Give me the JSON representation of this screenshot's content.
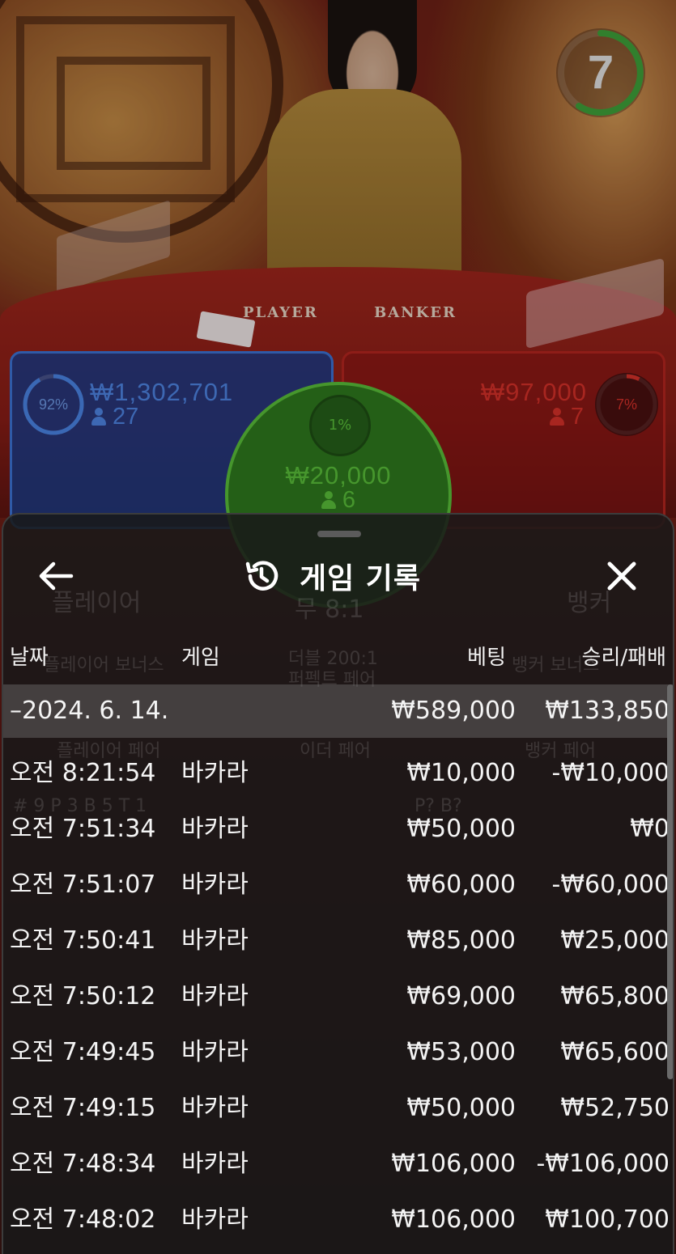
{
  "live_table": {
    "felt_labels": {
      "player": "PLAYER",
      "banker": "BANKER"
    },
    "countdown": {
      "value": "7",
      "ring_color": "#3fa33a"
    },
    "player_spot": {
      "percent": "92%",
      "stake": "₩1,302,701",
      "players": "27",
      "color": "#3d74d6"
    },
    "banker_spot": {
      "percent": "7%",
      "stake": "₩97,000",
      "players": "7",
      "color": "#d8312a"
    },
    "tie_spot": {
      "percent": "1%",
      "stake": "₩20,000",
      "players": "6",
      "color": "#5ac13a"
    }
  },
  "sheet": {
    "title": "게임 기록",
    "icons": {
      "back": "arrow-left-icon",
      "history": "history-icon",
      "close": "close-icon"
    },
    "columns": {
      "date": "날짜",
      "game": "게임",
      "bet": "베팅",
      "win_loss": "승리/패배"
    },
    "summary": {
      "date": "–2024. 6. 14.",
      "bet": "₩589,000",
      "win_loss": "₩133,850"
    },
    "rows": [
      {
        "time": "오전 8:21:54",
        "game": "바카라",
        "bet": "₩10,000",
        "win_loss": "-₩10,000"
      },
      {
        "time": "오전 7:51:34",
        "game": "바카라",
        "bet": "₩50,000",
        "win_loss": "₩0"
      },
      {
        "time": "오전 7:51:07",
        "game": "바카라",
        "bet": "₩60,000",
        "win_loss": "-₩60,000"
      },
      {
        "time": "오전 7:50:41",
        "game": "바카라",
        "bet": "₩85,000",
        "win_loss": "₩25,000"
      },
      {
        "time": "오전 7:50:12",
        "game": "바카라",
        "bet": "₩69,000",
        "win_loss": "₩65,800"
      },
      {
        "time": "오전 7:49:45",
        "game": "바카라",
        "bet": "₩53,000",
        "win_loss": "₩65,600"
      },
      {
        "time": "오전 7:49:15",
        "game": "바카라",
        "bet": "₩50,000",
        "win_loss": "₩52,750"
      },
      {
        "time": "오전 7:48:34",
        "game": "바카라",
        "bet": "₩106,000",
        "win_loss": "-₩106,000"
      },
      {
        "time": "오전 7:48:02",
        "game": "바카라",
        "bet": "₩106,000",
        "win_loss": "₩100,700"
      }
    ]
  },
  "background_ui": {
    "player_label": "플레이어",
    "tie_label": "무 8:1",
    "banker_label": "뱅커",
    "player_bonus": "플레이어 보너스",
    "perfect_pair": "퍼펙트 페어",
    "banker_bonus": "뱅커 보너스",
    "either_pair": "이더 페어",
    "player_pair": "플레이어 페어",
    "banker_pair": "뱅커 페어",
    "dragon_bonus": "더블 200:1",
    "stats": "# 9   P 3   B 5   T 1",
    "predictions": "P?            B?"
  }
}
